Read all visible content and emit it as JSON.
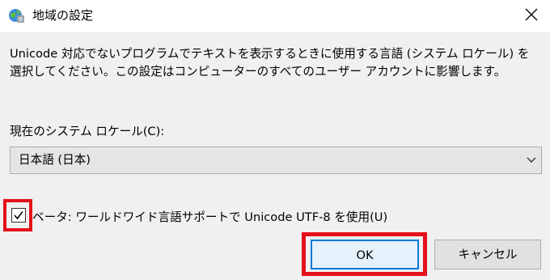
{
  "window": {
    "title": "地域の設定",
    "icon": "globe-settings-icon"
  },
  "description": "Unicode 対応でないプログラムでテキストを表示するときに使用する言語 (システム ロケール) を選択してください。この設定はコンピューターのすべてのユーザー アカウントに影響します。",
  "locale": {
    "label": "現在のシステム ロケール(C):",
    "selected": "日本語 (日本)"
  },
  "beta_option": {
    "label": "ベータ: ワールドワイド言語サポートで Unicode UTF-8 を使用(U)",
    "checked": true
  },
  "buttons": {
    "ok": "OK",
    "cancel": "キャンセル"
  },
  "colors": {
    "highlight": "#e5101a",
    "focus": "#0078d7",
    "client_bg": "#f0f0f0"
  }
}
